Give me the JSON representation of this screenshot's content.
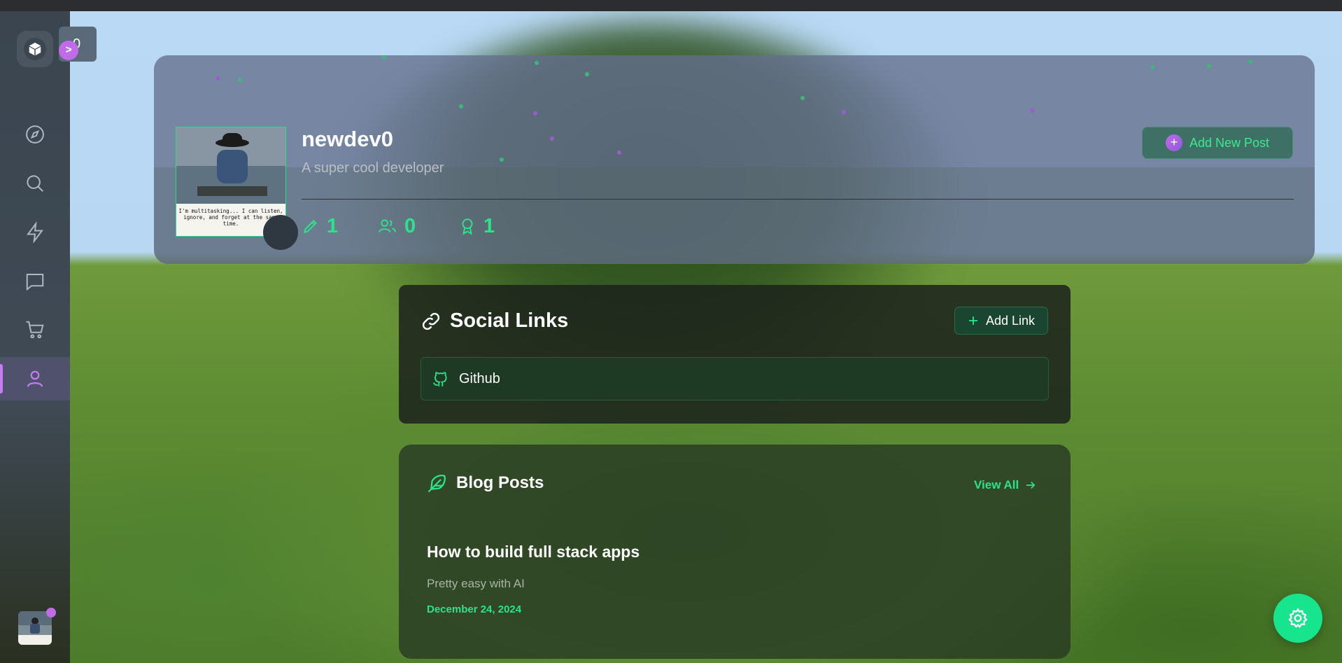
{
  "sidebar": {
    "toggle_text": "0",
    "expand_icon": ">",
    "items": [
      {
        "name": "explore",
        "icon": "compass-icon"
      },
      {
        "name": "search",
        "icon": "search-icon"
      },
      {
        "name": "activity",
        "icon": "lightning-icon"
      },
      {
        "name": "messages",
        "icon": "message-icon"
      },
      {
        "name": "shop",
        "icon": "cart-icon"
      },
      {
        "name": "profile",
        "icon": "user-icon",
        "active": true
      }
    ]
  },
  "profile": {
    "username": "newdev0",
    "bio": "A super cool developer",
    "avatar_caption": "I'm multitasking... I can listen, ignore, and forget at the same time.",
    "stats": {
      "posts": "1",
      "followers": "0",
      "badges": "1"
    },
    "add_post_label": "Add New Post"
  },
  "social": {
    "title": "Social Links",
    "add_label": "Add Link",
    "links": [
      {
        "label": "Github",
        "icon": "github-icon"
      }
    ]
  },
  "blog": {
    "title": "Blog Posts",
    "view_all_label": "View All",
    "posts": [
      {
        "title": "How to build full stack apps",
        "excerpt": "Pretty easy with AI",
        "date": "December 24, 2024"
      }
    ]
  },
  "colors": {
    "accent_green": "#2be38a",
    "accent_purple": "#c06be8",
    "fab": "#17e58e"
  }
}
